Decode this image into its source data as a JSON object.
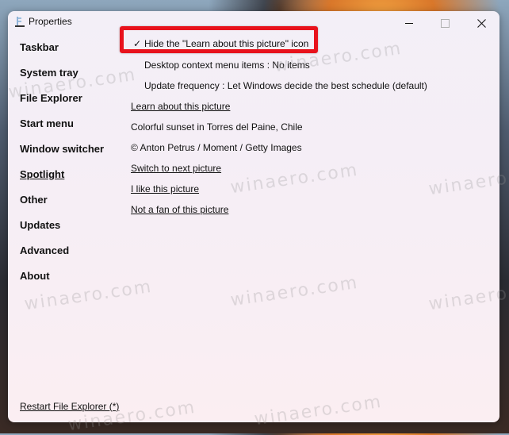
{
  "window": {
    "title": "Properties",
    "controls": {
      "minimize": "minimize",
      "maximize": "maximize",
      "close": "×"
    }
  },
  "sidebar": {
    "items": [
      {
        "label": "Taskbar",
        "active": false
      },
      {
        "label": "System tray",
        "active": false
      },
      {
        "label": "File Explorer",
        "active": false
      },
      {
        "label": "Start menu",
        "active": false
      },
      {
        "label": "Window switcher",
        "active": false
      },
      {
        "label": "Spotlight",
        "active": true
      },
      {
        "label": "Other",
        "active": false
      },
      {
        "label": "Updates",
        "active": false
      },
      {
        "label": "Advanced",
        "active": false
      },
      {
        "label": "About",
        "active": false
      }
    ],
    "restart_label": "Restart File Explorer (*)"
  },
  "spotlight": {
    "hide_icon_option": {
      "checkmark": "✓",
      "label": "Hide the \"Learn about this picture\" icon",
      "checked": true
    },
    "context_menu_option": "Desktop context menu items : No items",
    "update_frequency_option": "Update frequency : Let Windows decide the best schedule (default)",
    "learn_link": "Learn about this picture",
    "picture_title": "Colorful sunset in Torres del Paine, Chile",
    "picture_credit": "© Anton Petrus / Moment / Getty Images",
    "switch_link": "Switch to next picture",
    "like_link": "I like this picture",
    "dislike_link": "Not a fan of this picture"
  },
  "highlight_color": "#e8121c",
  "watermark": "winaero.com"
}
